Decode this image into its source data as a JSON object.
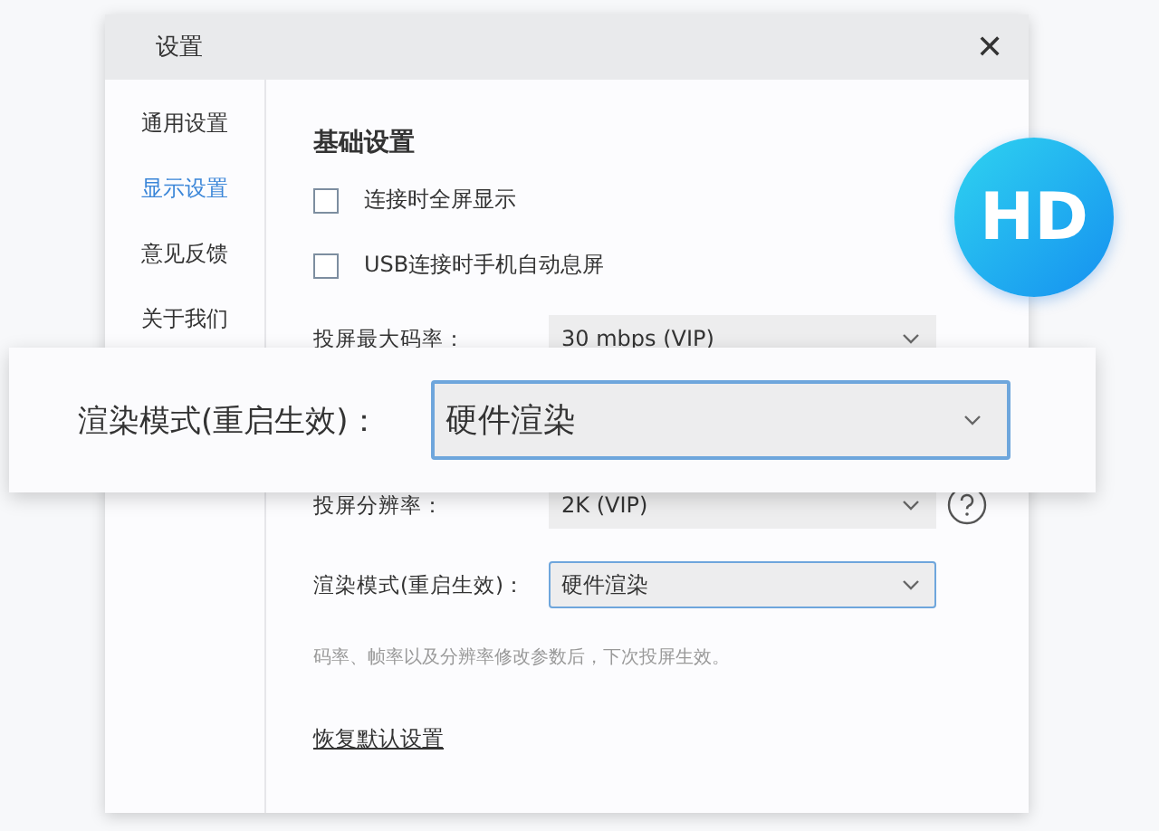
{
  "window": {
    "title": "设置",
    "close": "✕"
  },
  "sidebar": {
    "items": [
      {
        "label": "通用设置",
        "selected": false
      },
      {
        "label": "显示设置",
        "selected": true
      },
      {
        "label": "意见反馈",
        "selected": false
      },
      {
        "label": "关于我们",
        "selected": false
      }
    ]
  },
  "section_title": "基础设置",
  "checkboxes": [
    {
      "label": "连接时全屏显示",
      "checked": false
    },
    {
      "label": "USB连接时手机自动息屏",
      "checked": false
    }
  ],
  "fields": [
    {
      "label": "投屏最大码率：",
      "value": "30 mbps (VIP)",
      "focused": false,
      "help": false,
      "gap_after": true
    },
    {
      "label": "投屏分辨率：",
      "value": "2K (VIP)",
      "focused": false,
      "help": true,
      "gap_after": false
    },
    {
      "label": "渲染模式(重启生效)：",
      "value": "硬件渲染",
      "focused": true,
      "help": false,
      "gap_after": false
    }
  ],
  "note": "码率、帧率以及分辨率修改参数后，下次投屏生效。",
  "reset_link": "恢复默认设置",
  "callout": {
    "label": "渲染模式(重启生效)：",
    "value": "硬件渲染",
    "focused": true
  },
  "badge": "HD"
}
